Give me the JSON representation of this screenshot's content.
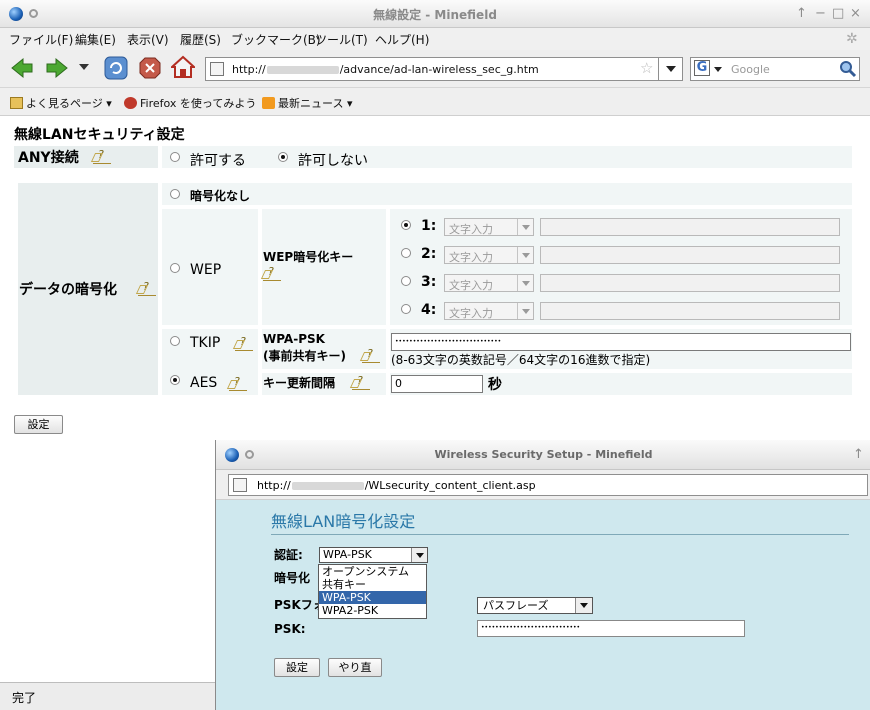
{
  "main_window": {
    "title": "無線設定 - Minefield",
    "menu": [
      "ファイル(F)",
      "編集(E)",
      "表示(V)",
      "履歴(S)",
      "ブックマーク(B)",
      "ツール(T)",
      "ヘルプ(H)"
    ],
    "url_prefix": "http://",
    "url_suffix": "/advance/ad-lan-wireless_sec_g.htm",
    "search_placeholder": "Google",
    "bookmarks": [
      "よく見るページ",
      "Firefox を使ってみよう",
      "最新ニュース"
    ],
    "status": "完了"
  },
  "form": {
    "title": "無線LANセキュリティ設定",
    "any_label": "ANY接続",
    "any_options": [
      "許可する",
      "許可しない"
    ],
    "any_selected": 1,
    "enc_label": "データの暗号化",
    "enc_none": "暗号化なし",
    "wep": "WEP",
    "wep_key_label": "WEP暗号化キー",
    "wep_keys": [
      {
        "num": "1:",
        "mode": "文字入力"
      },
      {
        "num": "2:",
        "mode": "文字入力"
      },
      {
        "num": "3:",
        "mode": "文字入力"
      },
      {
        "num": "4:",
        "mode": "文字入力"
      }
    ],
    "tkip": "TKIP",
    "aes": "AES",
    "enc_selected": "AES",
    "wpa_label_1": "WPA-PSK",
    "wpa_label_2": "(事前共有キー)",
    "wpa_value": "••••••••••••••••••••••••••••••",
    "wpa_hint": "(8-63文字の英数記号／64文字の16進数で指定)",
    "rekey_label": "キー更新間隔",
    "rekey_value": "0",
    "rekey_unit": "秒",
    "submit": "設定"
  },
  "popup": {
    "title": "Wireless Security Setup - Minefield",
    "url_prefix": "http://",
    "url_suffix": "/WLsecurity_content_client.asp",
    "heading": "無線LAN暗号化設定",
    "auth_label": "認証:",
    "auth_value": "WPA-PSK",
    "auth_options": [
      "オープンシステム",
      "共有キー",
      "WPA-PSK",
      "WPA2-PSK"
    ],
    "auth_selected": 2,
    "enc_label": "暗号化",
    "psk_format_label": "PSKフォ",
    "psk_format_value": "パスフレーズ",
    "psk_label": "PSK:",
    "psk_value": "••••••••••••••••••••••••••••",
    "btn_set": "設定",
    "btn_reset": "やり直"
  }
}
